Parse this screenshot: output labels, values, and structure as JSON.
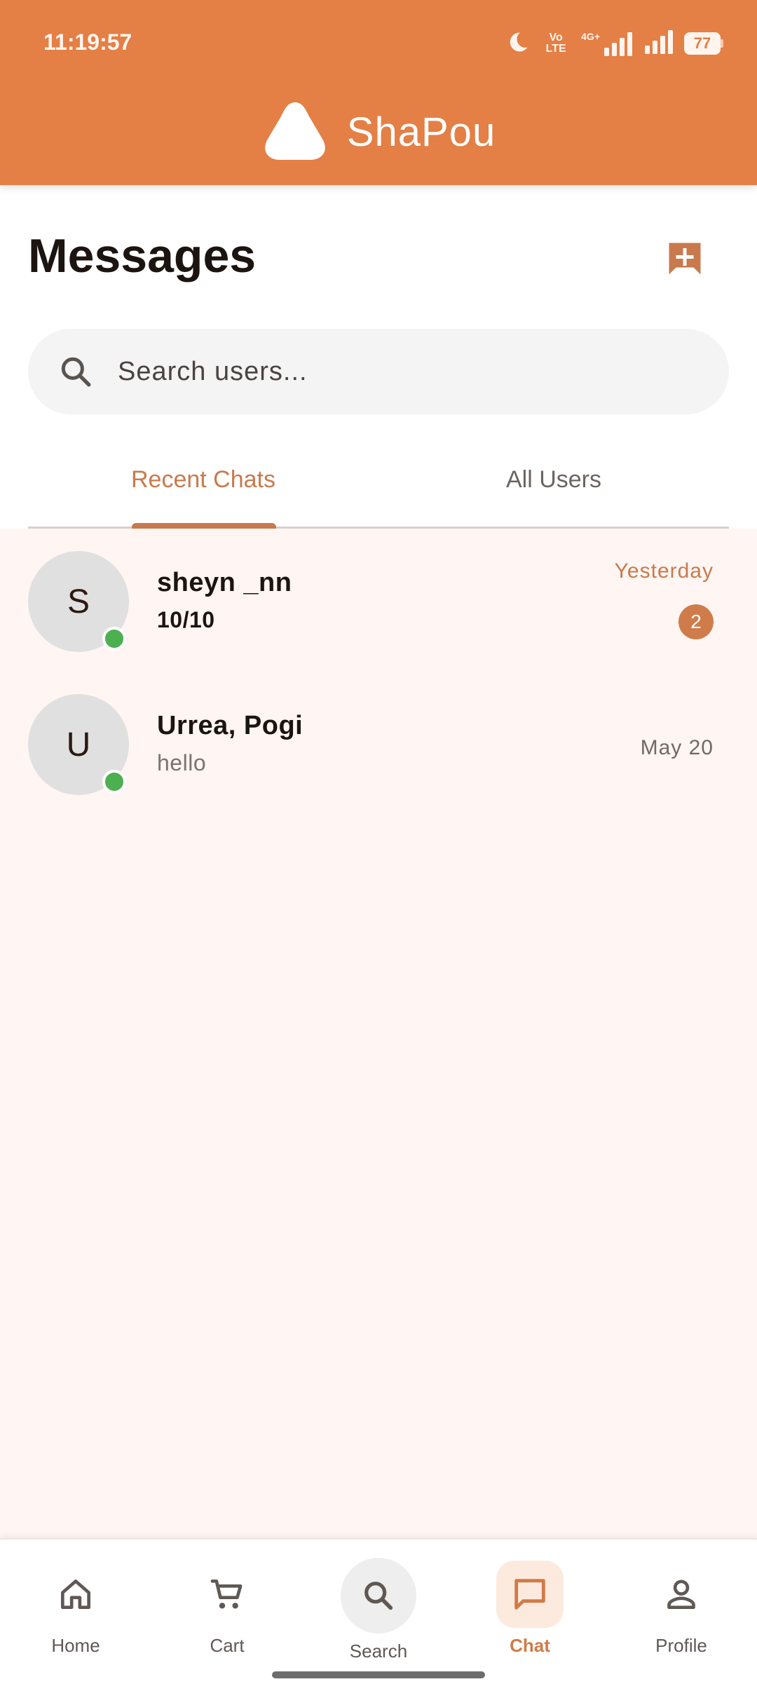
{
  "status_bar": {
    "time": "11:19:57",
    "volte_label": "Vo LTE",
    "network_label": "4G+",
    "battery": "77"
  },
  "app": {
    "name": "ShaPou",
    "brand_color": "#e47f45",
    "accent_color": "#c87a4e"
  },
  "page": {
    "title": "Messages",
    "new_chat_icon": "add-comment-icon"
  },
  "search": {
    "placeholder": "Search users...",
    "value": ""
  },
  "tabs": [
    {
      "label": "Recent Chats",
      "active": true
    },
    {
      "label": "All Users",
      "active": false
    }
  ],
  "chats": [
    {
      "initial": "S",
      "name": "sheyn _nn",
      "preview": "10/10",
      "time": "Yesterday",
      "unread_count": "2",
      "online": true
    },
    {
      "initial": "U",
      "name": "Urrea, Pogi",
      "preview": "hello",
      "time": "May 20",
      "unread_count": "",
      "online": true
    }
  ],
  "bottom_nav": [
    {
      "label": "Home",
      "icon": "home-icon",
      "active": false
    },
    {
      "label": "Cart",
      "icon": "cart-icon",
      "active": false
    },
    {
      "label": "Search",
      "icon": "search-icon",
      "active": false
    },
    {
      "label": "Chat",
      "icon": "chat-icon",
      "active": true
    },
    {
      "label": "Profile",
      "icon": "profile-icon",
      "active": false
    }
  ]
}
